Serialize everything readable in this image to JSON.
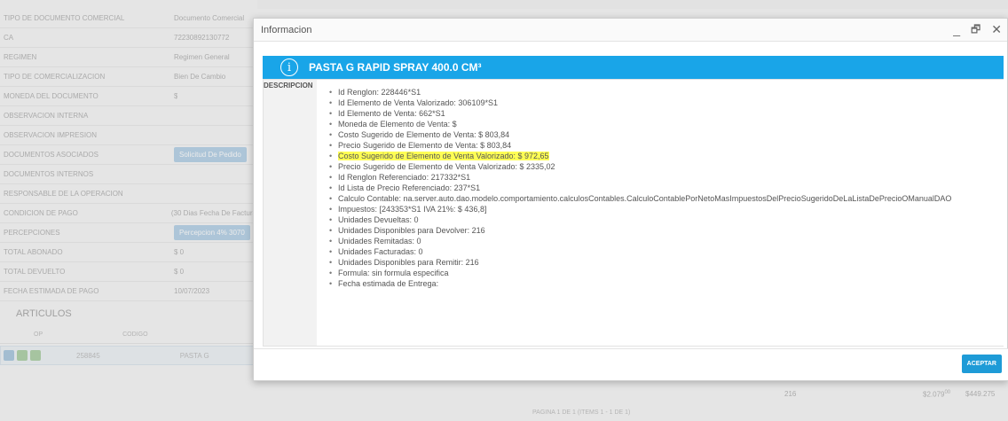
{
  "background": {
    "rows": [
      {
        "label": "TIPO DE DOCUMENTO COMERCIAL",
        "value": "Documento Comercial",
        "chip": false
      },
      {
        "label": "CA",
        "value": "72230892130772",
        "chip": false
      },
      {
        "label": "REGIMEN",
        "value": "Regimen General",
        "chip": false
      },
      {
        "label": "TIPO DE COMERCIALIZACION",
        "value": "Bien De Cambio",
        "chip": false
      },
      {
        "label": "MONEDA DEL DOCUMENTO",
        "value": "$",
        "chip": false
      },
      {
        "label": "OBSERVACION INTERNA",
        "value": "",
        "chip": false
      },
      {
        "label": "OBSERVACION IMPRESION",
        "value": "",
        "chip": false
      },
      {
        "label": "DOCUMENTOS ASOCIADOS",
        "value": "Solicitud De Pedido",
        "chip": true
      },
      {
        "label": "DOCUMENTOS INTERNOS",
        "value": "",
        "chip": false
      },
      {
        "label": "RESPONSABLE DE LA OPERACION",
        "value": "",
        "chip": false
      },
      {
        "label": "CONDICION DE PAGO",
        "value": "(30 Dias Fecha De Factura)",
        "chip": false
      },
      {
        "label": "PERCEPCIONES",
        "value": "Percepcion 4% 3070",
        "chip": true
      },
      {
        "label": "TOTAL ABONADO",
        "value": "$ 0",
        "chip": false
      },
      {
        "label": "TOTAL DEVUELTO",
        "value": "$ 0",
        "chip": false
      },
      {
        "label": "FECHA ESTIMADA DE PAGO",
        "value": "10/07/2023",
        "chip": false
      }
    ],
    "articulos": "ARTICULOS",
    "col_op": "OP",
    "col_codigo": "CODIGO",
    "row_code": "258845",
    "row_desc": "PASTA G",
    "qty": "216",
    "price1": "$2.079",
    "price1_sup": "00",
    "price2": "$449.275",
    "pager": "PAGINA 1 DE 1 (ITEMS 1 - 1 DE 1)"
  },
  "modal": {
    "title": "Informacion",
    "banner_title": "PASTA G RAPID SPRAY 400.0 CM³",
    "info_icon": "i",
    "desc_label": "DESCRIPCION",
    "details": [
      "Id Renglon: 228446*S1",
      "Id Elemento de Venta Valorizado: 306109*S1",
      "Id Elemento de Venta: 662*S1",
      "Moneda de Elemento de Venta: $",
      "Costo Sugerido de Elemento de Venta: $ 803,84",
      "Precio Sugerido de Elemento de Venta: $ 803,84",
      "Costo Sugerido de Elemento de Venta Valorizado: $ 972,65",
      "Precio Sugerido de Elemento de Venta Valorizado: $ 2335,02",
      "Id Renglon Referenciado: 217332*S1",
      "Id Lista de Precio Referenciado: 237*S1",
      "Calculo Contable: na.server.auto.dao.modelo.comportamiento.calculosContables.CalculoContablePorNetoMasImpuestosDelPrecioSugeridoDeLaListaDePrecioOManualDAO",
      "Impuestos: [243353*S1 IVA 21%: $ 436,8]",
      "Unidades Devueltas: 0",
      "Unidades Disponibles para Devolver: 216",
      "Unidades Remitadas: 0",
      "Unidades Facturadas: 0",
      "Unidades Disponibles para Remitir: 216",
      "Formula: sin formula especifica",
      "Fecha estimada de Entrega:"
    ],
    "highlight_index": 6,
    "accept_label": "ACEPTAR",
    "window_buttons": {
      "minimize": "_",
      "restore": "🗗",
      "close": "✕"
    }
  },
  "colors": {
    "accent": "#19a5e8",
    "highlight": "#ffff55",
    "button": "#1e9bd7"
  }
}
